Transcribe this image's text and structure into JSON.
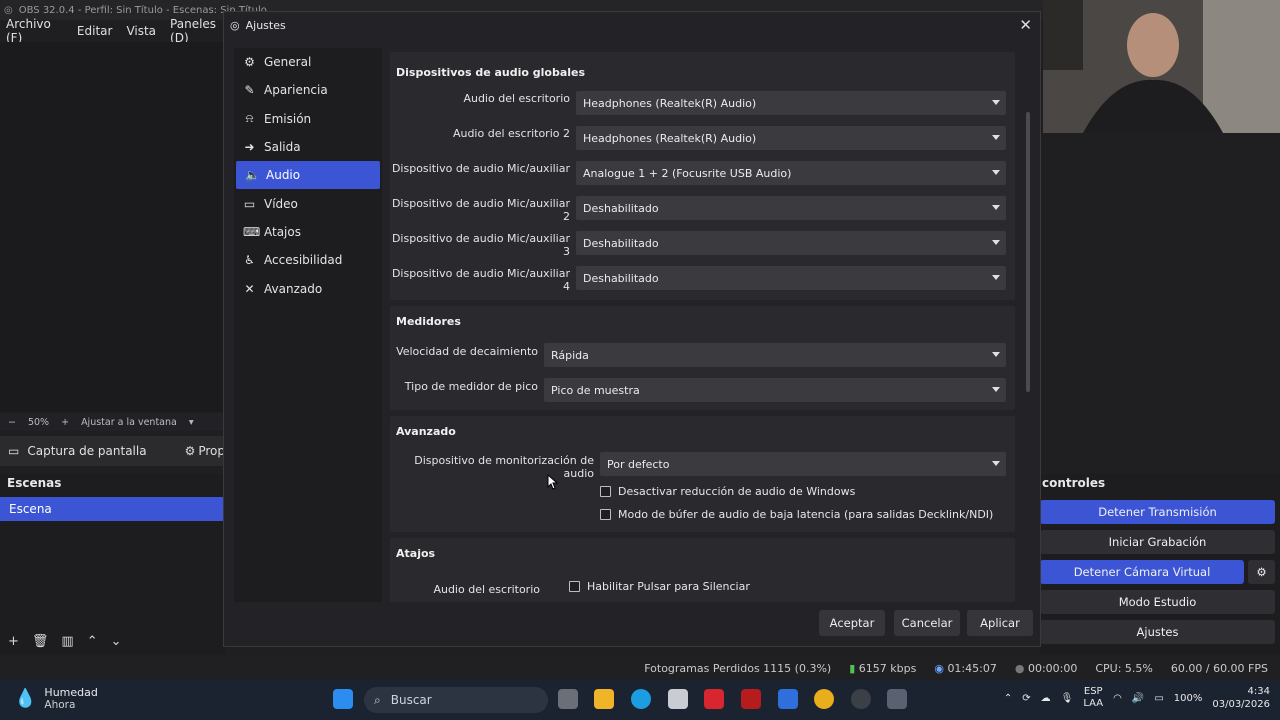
{
  "obs": {
    "title": "OBS 32.0.4 - Perfil: Sin Título - Escenas: Sin Título",
    "menu": [
      "Archivo (F)",
      "Editar",
      "Vista",
      "Paneles (D)"
    ],
    "zoom": {
      "minus": "−",
      "value": "50%",
      "plus": "+",
      "fit": "Ajustar a la ventana"
    },
    "source": {
      "name": "Captura de pantalla",
      "props": "Prop"
    },
    "scenes": {
      "header": "Escenas",
      "items": [
        "Escena"
      ]
    },
    "controls": {
      "header": "controles",
      "buttons": [
        "Detener Transmisión",
        "Iniciar Grabación",
        "Detener Cámara Virtual",
        "Modo Estudio",
        "Ajustes"
      ]
    },
    "status": {
      "dropped": "Fotogramas Perdidos 1115 (0.3%)",
      "bitrate": "6157 kbps",
      "stream_time": "01:45:07",
      "rec_time": "00:00:00",
      "cpu": "CPU: 5.5%",
      "fps": "60.00 / 60.00 FPS"
    }
  },
  "dialog": {
    "title": "Ajustes",
    "nav": [
      "General",
      "Apariencia",
      "Emisión",
      "Salida",
      "Audio",
      "Vídeo",
      "Atajos",
      "Accesibilidad",
      "Avanzado"
    ],
    "selected_nav": "Audio",
    "groups": {
      "global": {
        "title": "Dispositivos de audio globales",
        "rows": [
          {
            "label": "Audio del escritorio",
            "value": "Headphones (Realtek(R) Audio)"
          },
          {
            "label": "Audio del escritorio 2",
            "value": "Headphones (Realtek(R) Audio)"
          },
          {
            "label": "Dispositivo de audio Mic/auxiliar",
            "value": "Analogue 1 + 2 (Focusrite USB Audio)"
          },
          {
            "label": "Dispositivo de audio Mic/auxiliar 2",
            "value": "Deshabilitado"
          },
          {
            "label": "Dispositivo de audio Mic/auxiliar 3",
            "value": "Deshabilitado"
          },
          {
            "label": "Dispositivo de audio Mic/auxiliar 4",
            "value": "Deshabilitado"
          }
        ]
      },
      "meters": {
        "title": "Medidores",
        "rows": [
          {
            "label": "Velocidad de decaimiento",
            "value": "Rápida"
          },
          {
            "label": "Tipo de medidor de pico",
            "value": "Pico de muestra"
          }
        ]
      },
      "advanced": {
        "title": "Avanzado",
        "monitor_label": "Dispositivo de monitorización de audio",
        "monitor_value": "Por defecto",
        "checkboxes": [
          "Desactivar reducción de audio de Windows",
          "Modo de búfer de audio de baja latencia (para salidas Decklink/NDI)"
        ]
      },
      "hotkeys": {
        "title": "Atajos",
        "row_label": "Audio del escritorio",
        "checkbox": "Habilitar Pulsar para Silenciar"
      }
    },
    "buttons": {
      "ok": "Aceptar",
      "cancel": "Cancelar",
      "apply": "Aplicar"
    }
  },
  "taskbar": {
    "weather_title": "Humedad",
    "weather_sub": "Ahora",
    "search": "Buscar",
    "lang1": "ESP",
    "lang2": "LAA",
    "battery": "100%",
    "time": "4:34",
    "date": "03/03/2026"
  }
}
